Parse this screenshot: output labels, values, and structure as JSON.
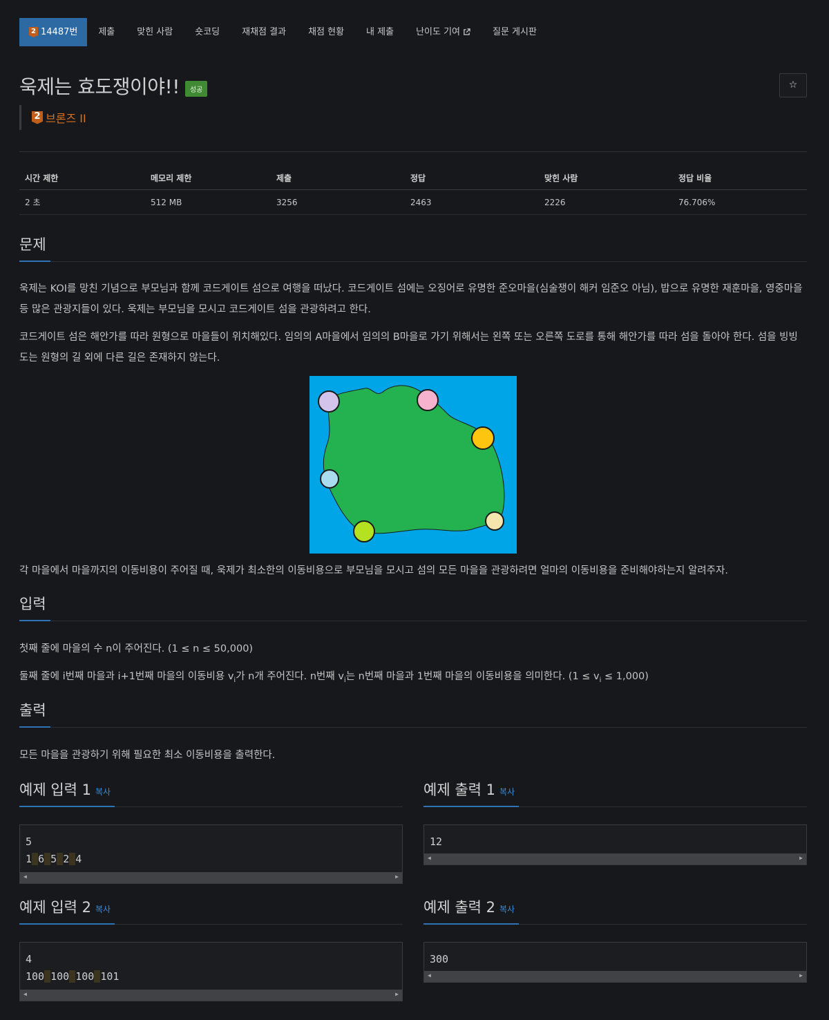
{
  "nav": {
    "items": [
      {
        "label": "14487번",
        "active": true,
        "icon": "tier-badge"
      },
      {
        "label": "제출"
      },
      {
        "label": "맞힌 사람"
      },
      {
        "label": "숏코딩"
      },
      {
        "label": "재채점 결과"
      },
      {
        "label": "채점 현황"
      },
      {
        "label": "내 제출"
      },
      {
        "label": "난이도 기여",
        "icon": "external-link-icon"
      },
      {
        "label": "질문 게시판"
      }
    ],
    "tier_badge_num": "2"
  },
  "problem": {
    "title": "욱제는 효도쟁이야!!",
    "status_label": "성공",
    "tier": "브론즈 II",
    "tier_num": "2",
    "star": "☆"
  },
  "info": {
    "headers": [
      "시간 제한",
      "메모리 제한",
      "제출",
      "정답",
      "맞힌 사람",
      "정답 비율"
    ],
    "values": [
      "2 초",
      "512 MB",
      "3256",
      "2463",
      "2226",
      "76.706%"
    ]
  },
  "sections": {
    "problem": "문제",
    "input": "입력",
    "output": "출력"
  },
  "text": {
    "p1": "욱제는 KOI를 망친 기념으로 부모님과 함께 코드게이트 섬으로 여행을 떠났다. 코드게이트 섬에는 오징어로 유명한 준오마을(심술쟁이 해커 임준오 아님), 밥으로 유명한 재훈마을, 영중마을 등 많은 관광지들이 있다. 욱제는 부모님을 모시고 코드게이트 섬을 관광하려고 한다.",
    "p2": "코드게이트 섬은 해안가를 따라 원형으로 마을들이 위치해있다. 임의의 A마을에서 임의의 B마을로 가기 위해서는 왼쪽 또는 오른쪽 도로를 통해 해안가를 따라 섬을 돌아야 한다. 섬을 빙빙 도는 원형의 길 외에 다른 길은 존재하지 않는다.",
    "p3": "각 마을에서 마을까지의 이동비용이 주어질 때, 욱제가 최소한의 이동비용으로 부모님을 모시고 섬의 모든 마을을 관광하려면 얼마의 이동비용을 준비해야하는지 알려주자.",
    "in1": "첫째 줄에 마을의 수 n이 주어진다. (1 ≤ n ≤ 50,000)",
    "in2_a": "둘째 줄에 i번째 마을과 i+1번째 마을의 이동비용 v",
    "in2_b": "i",
    "in2_c": "가 n개 주어진다. n번째 v",
    "in2_d": "i",
    "in2_e": "는 n번째 마을과 1번째 마을의 이동비용을 의미한다. (1 ≤ v",
    "in2_f": "i",
    "in2_g": " ≤ 1,000)",
    "out1": "모든 마을을 관광하기 위해 필요한 최소 이동비용을 출력한다."
  },
  "samples": {
    "in1_title": "예제 입력 1",
    "out1_title": "예제 출력 1",
    "in2_title": "예제 입력 2",
    "out2_title": "예제 출력 2",
    "copy": "복사",
    "in1_line1": "5",
    "in1_nums": [
      "1",
      "6",
      "5",
      "2",
      "4"
    ],
    "out1": "12",
    "in2_line1": "4",
    "in2_nums": [
      "100",
      "100",
      "100",
      "101"
    ],
    "out2": "300"
  },
  "colors": {
    "accent": "#2d73b5",
    "tier_bronze": "#d9711e",
    "success": "#3f8a33",
    "sea": "#00a5e8",
    "land": "#24b150"
  },
  "villages": [
    {
      "color": "#d4c4ec"
    },
    {
      "color": "#f7b3cd"
    },
    {
      "color": "#fdc50f"
    },
    {
      "color": "#a8dcee"
    },
    {
      "color": "#b4e221"
    },
    {
      "color": "#f4e6ad"
    }
  ]
}
